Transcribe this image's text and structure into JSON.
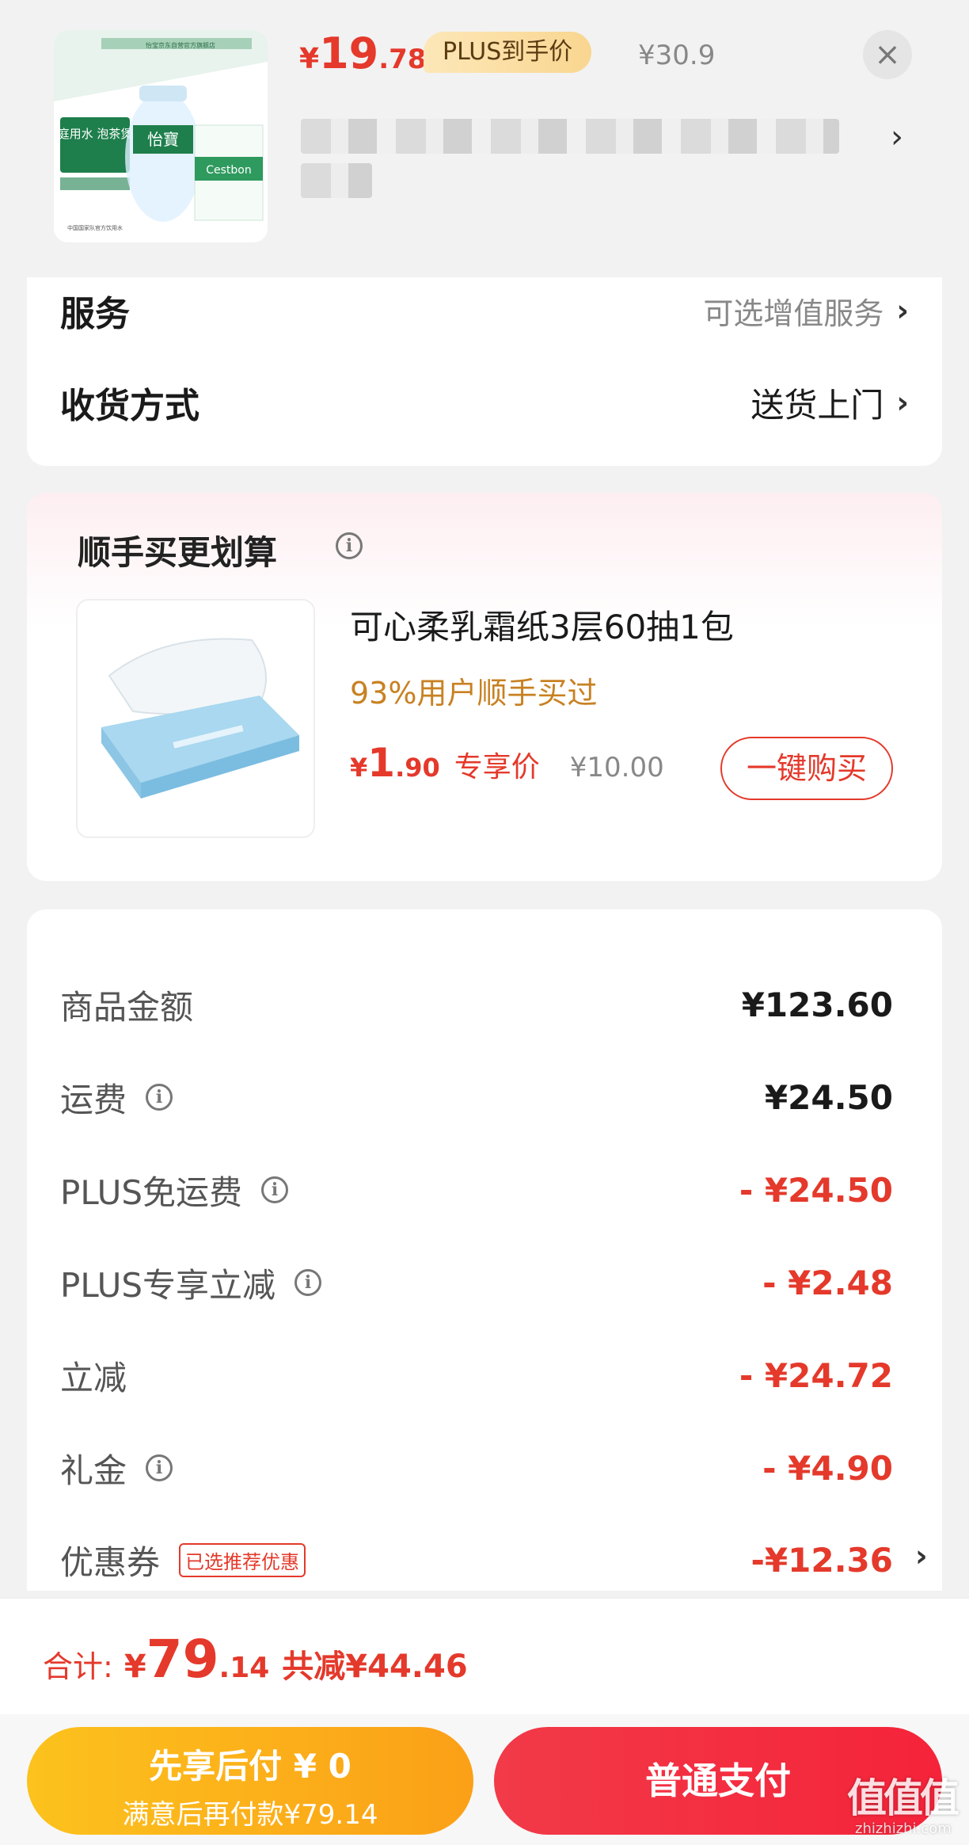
{
  "product": {
    "price_yen": "¥",
    "price_int": "19",
    "price_dec": ".78",
    "plus_badge": "PLUS到手价",
    "original_price": "¥30.9",
    "close_label": "×",
    "chevron": "›",
    "image_texts": {
      "store": "怡宝京东自营官方旗舰店",
      "slogan": "家庭用水 泡茶煲汤",
      "brand": "怡寶",
      "brand_en": "Cestbon",
      "note": "中国国家队官方饮用水"
    }
  },
  "service_row": {
    "label": "服务",
    "value": "可选增值服务",
    "chevron": "›"
  },
  "delivery_row": {
    "label": "收货方式",
    "value": "送货上门",
    "chevron": "›"
  },
  "recommendation": {
    "title": "顺手买更划算",
    "info_icon": "i",
    "name": "可心柔乳霜纸3层60抽1包",
    "social_proof": "93%用户顺手买过",
    "price_yen": "¥",
    "price_int": "1",
    "price_dec": ".90",
    "price_tag": "专享价",
    "original_price": "¥10.00",
    "buy_button": "一键购买"
  },
  "fees": [
    {
      "label": "商品金额",
      "value": "¥123.60",
      "info": false,
      "red": false
    },
    {
      "label": "运费",
      "value": "¥24.50",
      "info": true,
      "red": false
    },
    {
      "label": "PLUS免运费",
      "value": "- ¥24.50",
      "info": true,
      "red": true
    },
    {
      "label": "PLUS专享立减",
      "value": "- ¥2.48",
      "info": true,
      "red": true
    },
    {
      "label": "立减",
      "value": "- ¥24.72",
      "info": false,
      "red": true
    },
    {
      "label": "礼金",
      "value": "- ¥4.90",
      "info": true,
      "red": true
    },
    {
      "label": "优惠券",
      "value": "-¥12.36",
      "info": false,
      "red": true,
      "tag": "已选推荐优惠",
      "chevron": "›"
    }
  ],
  "total": {
    "label": "合计:",
    "yen": "¥",
    "int": "79",
    "dec": ".14",
    "saved": "共减¥44.46"
  },
  "actions": {
    "pay_later_title": "先享后付 ¥ 0",
    "pay_later_sub": "满意后再付款¥79.14",
    "pay_normal": "普通支付"
  },
  "watermark": {
    "text": "值值值",
    "sub": "zhizhizhi.com"
  },
  "colors": {
    "accent_red": "#e4392b",
    "social_proof_orange": "#c88122",
    "pay_later_yellow": "#fba017",
    "pay_normal_red": "#f5233a"
  }
}
